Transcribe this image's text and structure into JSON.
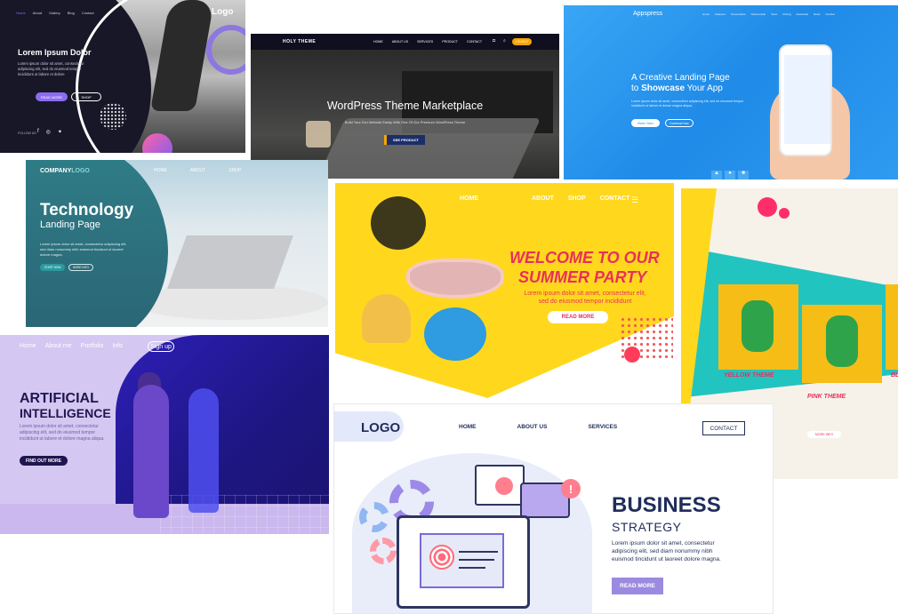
{
  "card1": {
    "nav": [
      "Home",
      "About",
      "Gallery",
      "Blog",
      "Contact"
    ],
    "logo": "Logo",
    "title": "Lorem Ipsum Dolor",
    "body": "Lorem ipsum dolor sit amet, consectetur adipiscing elit, sed do eiusmod tempor incididunt ut labore et dolore",
    "read_more": "READ MORE",
    "shop": "SHOP",
    "follow": "FOLLOW US",
    "accent": "#8b6cf1"
  },
  "card2": {
    "logo": "HOLY THEME",
    "nav": [
      "HOME",
      "ABOUT US",
      "SERVICES",
      "PRODUCT",
      "CONTACT"
    ],
    "cta_nav": "CONTACT",
    "title": "WordPress Theme Marketplace",
    "subtitle": "Build Your Divi Website Easily With One Of Our Premium WordPress Theme",
    "button": "SEE PRODUCT",
    "accent": "#f7a400"
  },
  "card3": {
    "logo": "Appspress",
    "nav": [
      "Home",
      "Features",
      "Screenshots",
      "Testimonials",
      "Team",
      "Pricing",
      "Download",
      "News",
      "Contact"
    ],
    "headline1": "A Creative Landing Page",
    "headline2_prefix": "to ",
    "headline2_bold": "Showcase",
    "headline2_suffix": " Your App",
    "body": "Lorem ipsum dolor sit amet, consectetur adipiscing elit, sed do eiusmod tempor incididunt ut labore et dolore magna aliqua.",
    "btn1": "Watch Video",
    "btn2": "Download Now",
    "bg": "#2a96ee"
  },
  "card4": {
    "logo_company": "COMPANY",
    "logo_logo": "LOGO",
    "nav": [
      "HOME",
      "ABOUT",
      "SHOP"
    ],
    "title": "Technology",
    "subtitle": "Landing Page",
    "body": "Lorem ipsum dolor sit amet, consectetur adipiscing elit, sed diam nonummy nibh euismod tincidunt ut laoreet dolore magna.",
    "btn1": "START NOW",
    "btn2": "MORE INFO"
  },
  "card5": {
    "nav": [
      "HOME",
      "ABOUT",
      "SHOP",
      "CONTACT"
    ],
    "title1": "WELCOME TO OUR",
    "title2": "SUMMER PARTY",
    "body": "Lorem ipsum dolor sit amet, consectetur elit, sed do eiusmod tempor incididunt",
    "button": "READ MORE",
    "accent": "#e8305a"
  },
  "card6": {
    "label1": "YELLOW THEME",
    "label2": "PINK THEME",
    "label3": "BL",
    "more_info": "MORE INFO",
    "accent": "#e8305a"
  },
  "card7": {
    "nav": [
      "Home",
      "About me",
      "Portfolio",
      "Info"
    ],
    "signup": "Sign up",
    "title1": "ARTIFICIAL",
    "title2": "INTELLIGENCE",
    "body": "Lorem ipsum dolor sit amet, consectetur adipiscing elit, sed do eiusmod tempor incididunt ut labore et dolore magna aliqua.",
    "button": "FIND OUT MORE"
  },
  "card8": {
    "logo": "LOGO",
    "nav": [
      "HOME",
      "ABOUT US",
      "SERVICES"
    ],
    "contact": "CONTACT",
    "title": "BUSINESS",
    "subtitle": "STRATEGY",
    "body": "Lorem ipsum dolor sit amet, consectetur adipiscing elit, sed diam nonummy nibh euismod tincidunt ut laoreet dolore magna.",
    "button": "READ MORE",
    "accent": "#9b8ae0",
    "navy": "#1f2d5a"
  }
}
